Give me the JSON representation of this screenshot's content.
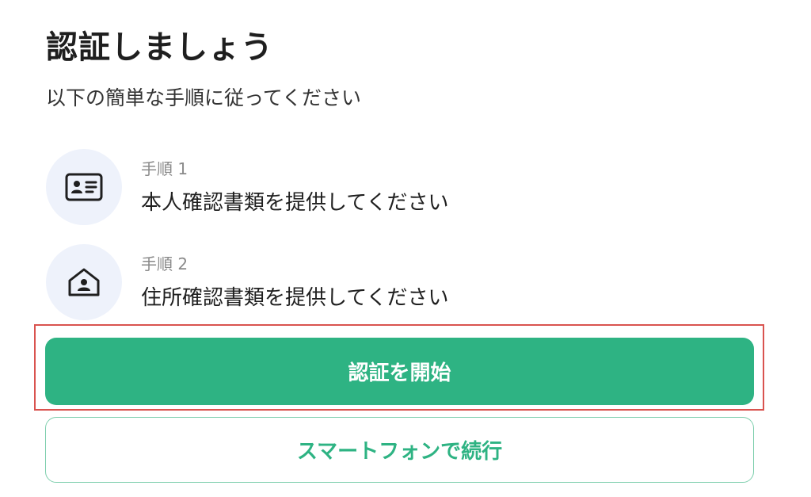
{
  "header": {
    "title": "認証しましょう",
    "subtitle": "以下の簡単な手順に従ってください"
  },
  "steps": [
    {
      "label": "手順 1",
      "text": "本人確認書類を提供してください",
      "icon": "id-card-icon"
    },
    {
      "label": "手順 2",
      "text": "住所確認書類を提供してください",
      "icon": "home-person-icon"
    }
  ],
  "actions": {
    "primary_label": "認証を開始",
    "secondary_label": "スマートフォンで続行"
  },
  "colors": {
    "accent": "#2eb383",
    "icon_bg": "#eef2fb",
    "highlight": "#d9534f"
  }
}
